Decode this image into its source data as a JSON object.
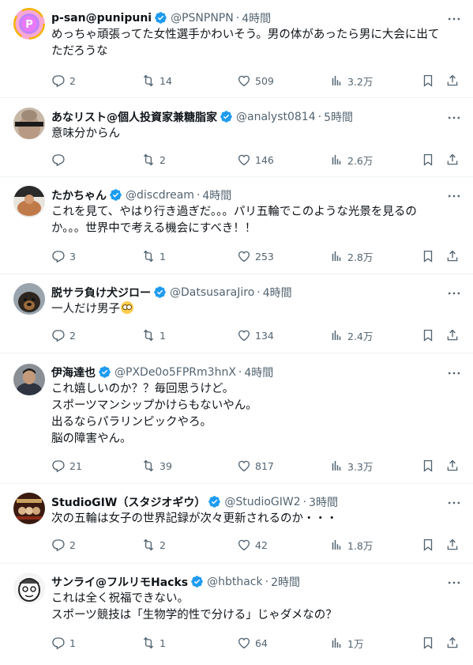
{
  "tweets": [
    {
      "name": "p-san@punipuni",
      "handle": "@PSNPNPN",
      "time": "4時間",
      "lines": [
        "めっちゃ頑張ってた女性選手かわいそう。男の体があったら男に大会に出て",
        "ただろうな"
      ],
      "replies": "2",
      "retweets": "14",
      "likes": "509",
      "views": "3.2万",
      "avatar_icon": "p-logo-avatar"
    },
    {
      "name": "あなリスト@個人投資家兼糖脂家",
      "handle": "@analyst0814",
      "time": "5時間",
      "lines": [
        "意味分からん"
      ],
      "replies": "",
      "retweets": "2",
      "likes": "146",
      "views": "2.6万",
      "avatar_icon": "person-photo-avatar"
    },
    {
      "name": "たかちゃん",
      "handle": "@discdream",
      "time": "4時間",
      "lines": [
        "これを見て、やはり行き過ぎだ。。。パリ五輪でこのような光景を見るの",
        "か。。。世界中で考える機会にすべき！！"
      ],
      "replies": "3",
      "retweets": "1",
      "likes": "253",
      "views": "2.8万",
      "avatar_icon": "person-photo-avatar"
    },
    {
      "name": "脱サラ負け犬ジロー",
      "handle": "@DatsusaraJiro",
      "time": "4時間",
      "lines": [
        "一人だけ男子"
      ],
      "emoji_after": "face-with-rolling-eyes-emoji",
      "replies": "2",
      "retweets": "1",
      "likes": "134",
      "views": "2.4万",
      "avatar_icon": "dog-photo-avatar"
    },
    {
      "name": "伊海達也",
      "handle": "@PXDe0o5FPRm3hnX",
      "time": "4時間",
      "lines": [
        "これ嬉しいのか？？毎回思うけど。",
        "スポーツマンシップかけらもないやん。",
        "出るならパラリンピックやろ。",
        "脳の障害やん。"
      ],
      "replies": "21",
      "retweets": "39",
      "likes": "817",
      "views": "3.3万",
      "avatar_icon": "person-photo-avatar"
    },
    {
      "name": "StudioGIW（スタジオギウ）",
      "handle": "@StudioGIW2",
      "time": "3時間",
      "lines": [
        "次の五輪は女子の世界記録が次々更新されるのか・・・"
      ],
      "replies": "2",
      "retweets": "2",
      "likes": "42",
      "views": "1.8万",
      "avatar_icon": "studio-logo-avatar"
    },
    {
      "name": "サンライ@フルリモHacks",
      "handle": "@hbthack",
      "time": "2時間",
      "lines": [
        "これは全く祝福できない。",
        "スポーツ競技は「生物学的性で分ける」じゃダメなの？"
      ],
      "replies": "1",
      "retweets": "1",
      "likes": "64",
      "views": "1万",
      "avatar_icon": "cartoon-avatar"
    }
  ],
  "colors": {
    "verified": "#1d9bf0",
    "icon": "#536471",
    "text": "#0f1419",
    "divider": "#eff3f4"
  }
}
